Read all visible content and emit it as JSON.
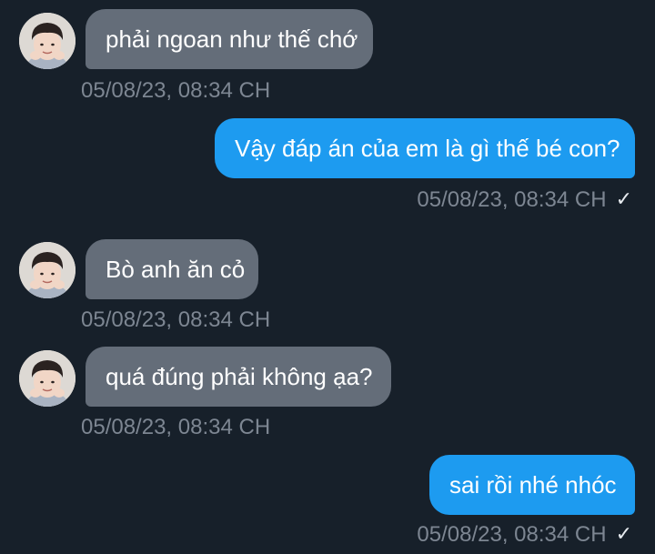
{
  "messages": [
    {
      "text": "phải ngoan như thế chớ",
      "time": "05/08/23, 08:34 CH",
      "direction": "incoming"
    },
    {
      "text": "Vậy đáp án của em là gì thế bé con?",
      "time": "05/08/23, 08:34 CH",
      "direction": "outgoing",
      "status_icon": "check-icon"
    },
    {
      "text": "Bò anh ăn cỏ",
      "time": "05/08/23, 08:34 CH",
      "direction": "incoming"
    },
    {
      "text": "quá đúng phải không ạa?",
      "time": "05/08/23, 08:34 CH",
      "direction": "incoming"
    },
    {
      "text": "sai rồi nhé nhóc",
      "time": "05/08/23, 08:34 CH",
      "direction": "outgoing",
      "status_icon": "check-icon"
    }
  ],
  "colors": {
    "background": "#17202a",
    "incoming_bubble": "#646d79",
    "outgoing_bubble": "#1d9bf0",
    "timestamp": "#7d8692"
  }
}
